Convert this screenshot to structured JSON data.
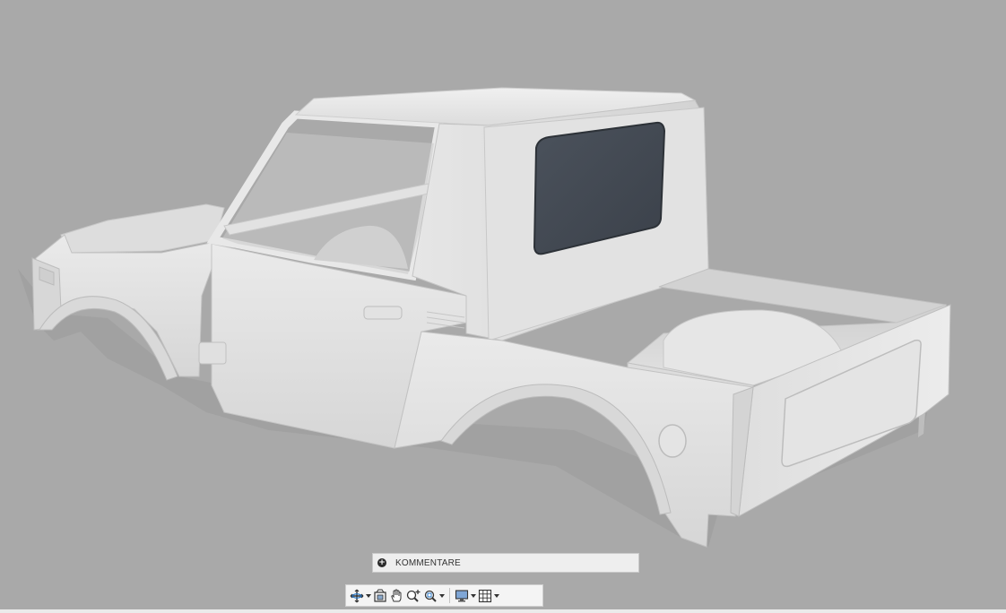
{
  "comments": {
    "label": "KOMMENTARE",
    "add_icon": "plus-circle-icon"
  },
  "toolbar": {
    "tools": [
      {
        "name": "orbit-icon",
        "dropdown": true
      },
      {
        "name": "look-at-icon",
        "dropdown": false
      },
      {
        "name": "pan-hand-icon",
        "dropdown": false
      },
      {
        "name": "zoom-icon",
        "dropdown": false
      },
      {
        "name": "fit-zoom-icon",
        "dropdown": true
      },
      {
        "name": "display-settings-icon",
        "dropdown": true
      },
      {
        "name": "grid-snap-icon",
        "dropdown": true
      }
    ]
  },
  "colors": {
    "background": "#a9a9a9",
    "body": "#e7e7e7",
    "glass": "#444b55"
  }
}
